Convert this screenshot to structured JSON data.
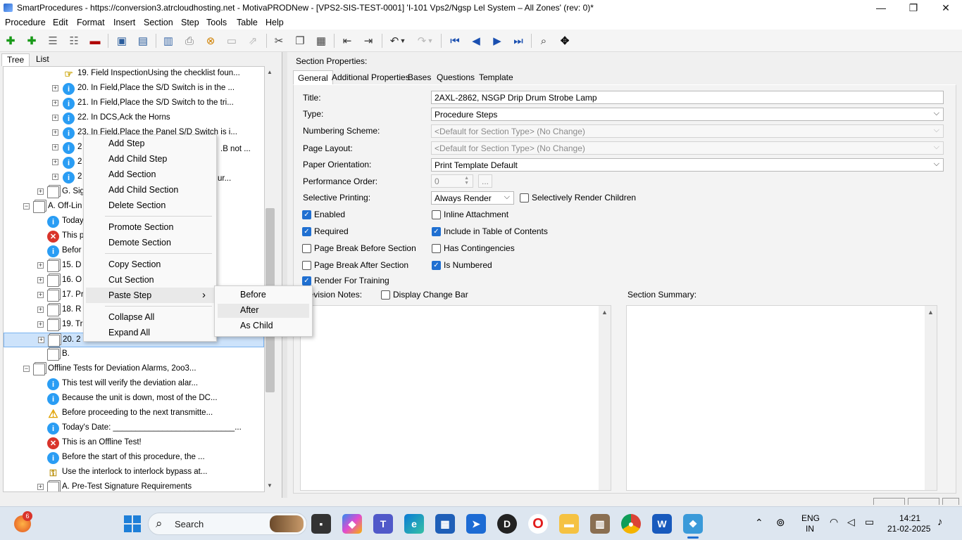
{
  "window": {
    "title": "SmartProcedures - https://conversion3.atrcloudhosting.net - MotivaPRODNew - [VPS2-SIS-TEST-0001] 'I-101 Vps2/Ngsp Lel System – All Zones' (rev: 0)*",
    "minimize": "—",
    "maximize": "❐",
    "close": "✕"
  },
  "menu": [
    "Procedure",
    "Edit",
    "Format",
    "Insert",
    "Section",
    "Step",
    "Tools",
    "Table",
    "Help"
  ],
  "left_tabs": [
    "Tree",
    "List"
  ],
  "tree": [
    {
      "text": "19. Field InspectionUsing the checklist foun...",
      "icon": "hand",
      "exp": ""
    },
    {
      "text": "20. In Field,Place the S/D Switch is in the ...",
      "icon": "info",
      "exp": "+"
    },
    {
      "text": "21. In Field,Place the S/D Switch to the tri...",
      "icon": "info",
      "exp": "+"
    },
    {
      "text": "22. In DCS,Ack the Horns",
      "icon": "info",
      "exp": "+"
    },
    {
      "text": "23. In Field,Place the Panel S/D Switch is i...",
      "icon": "info",
      "exp": "+"
    },
    {
      "text": "2",
      "icon": "info",
      "exp": "+"
    },
    {
      "text": "2",
      "icon": "info",
      "exp": "+"
    },
    {
      "text": "2",
      "icon": "info",
      "exp": "+"
    },
    {
      "text": "G. Sig",
      "icon": "sec",
      "exp": "+"
    },
    {
      "text": "A. Off-Lin",
      "icon": "sec",
      "exp": "−"
    },
    {
      "text": "Today",
      "icon": "info",
      "exp": ""
    },
    {
      "text": "This p",
      "icon": "err",
      "exp": ""
    },
    {
      "text": "Befor",
      "icon": "info",
      "exp": ""
    },
    {
      "text": "15. D",
      "icon": "sec",
      "exp": "+"
    },
    {
      "text": "16. O",
      "icon": "sec",
      "exp": "+"
    },
    {
      "text": "17. Pr",
      "icon": "sec",
      "exp": "+"
    },
    {
      "text": "18. R",
      "icon": "sec",
      "exp": "+"
    },
    {
      "text": "19. Tr",
      "icon": "sec",
      "exp": "+"
    },
    {
      "text": "20. 2",
      "icon": "sec",
      "exp": "+"
    },
    {
      "text": "B.",
      "icon": "sec",
      "exp": ""
    },
    {
      "text": "Offline Tests for Deviation Alarms, 2oo3...",
      "icon": "sec",
      "exp": "−"
    },
    {
      "text": "This test will verify the deviation alar...",
      "icon": "info",
      "exp": ""
    },
    {
      "text": "Because the unit is down, most of the DC...",
      "icon": "info",
      "exp": ""
    },
    {
      "text": "Before proceeding to the next transmitte...",
      "icon": "warn",
      "exp": ""
    },
    {
      "text": "Today's Date: ___________________________...",
      "icon": "info",
      "exp": ""
    },
    {
      "text": "This is an Offline Test!",
      "icon": "err",
      "exp": ""
    },
    {
      "text": "Before the start of this procedure, the ...",
      "icon": "info",
      "exp": ""
    },
    {
      "text": "Use the interlock to interlock bypass at...",
      "icon": "lock",
      "exp": ""
    },
    {
      "text": "A. Pre-Test Signature Requirements",
      "icon": "sec",
      "exp": "+"
    }
  ],
  "tree_partial": [
    ".B not ...",
    "ur..."
  ],
  "context_menu": {
    "items": [
      "Add Step",
      "Add Child Step",
      "Add Section",
      "Add Child Section",
      "Delete Section",
      "Promote Section",
      "Demote Section",
      "Copy Section",
      "Cut Section",
      "Paste Step",
      "Collapse All",
      "Expand All"
    ],
    "arrow": "›"
  },
  "submenu": [
    "Before",
    "After",
    "As Child"
  ],
  "section_properties": {
    "header": "Section Properties:",
    "tabs": [
      "General",
      "Additional Properties",
      "Bases",
      "Questions",
      "Template"
    ],
    "labels": {
      "title": "Title:",
      "type": "Type:",
      "numbering": "Numbering Scheme:",
      "page_layout": "Page Layout:",
      "paper_orientation": "Paper Orientation:",
      "performance_order": "Performance Order:",
      "selective_printing": "Selective Printing:",
      "revision_notes": "Revision Notes:",
      "section_summary": "Section Summary:"
    },
    "values": {
      "title": "2AXL-2862, NSGP Drip Drum Strobe Lamp",
      "type": "Procedure Steps",
      "numbering": "<Default for Section Type> (No Change)",
      "page_layout": "<Default for Section Type> (No Change)",
      "paper_orientation": "Print Template Default",
      "performance_order": "0",
      "selective_printing": "Always Render",
      "perf_btn": "..."
    },
    "checkboxes": {
      "selectively_render_children": {
        "label": "Selectively Render Children",
        "checked": false
      },
      "enabled": {
        "label": "Enabled",
        "checked": true
      },
      "inline_attachment": {
        "label": "Inline Attachment",
        "checked": false
      },
      "required": {
        "label": "Required",
        "checked": true
      },
      "include_toc": {
        "label": "Include in Table of Contents",
        "checked": true
      },
      "page_break_before": {
        "label": "Page Break Before Section",
        "checked": false
      },
      "has_contingencies": {
        "label": "Has Contingencies",
        "checked": false
      },
      "page_break_after": {
        "label": "Page Break After Section",
        "checked": false
      },
      "is_numbered": {
        "label": "Is Numbered",
        "checked": true
      },
      "render_for_training": {
        "label": "Render For Training",
        "checked": true
      },
      "display_change_bar": {
        "label": "Display Change Bar",
        "checked": false
      }
    }
  },
  "taskbar": {
    "search": "Search",
    "lang": "ENG",
    "region": "IN",
    "time": "14:21",
    "date": "21-02-2025",
    "badge": "6"
  },
  "colors": {
    "accent": "#1f6fd1",
    "selection": "#cde3fb"
  }
}
